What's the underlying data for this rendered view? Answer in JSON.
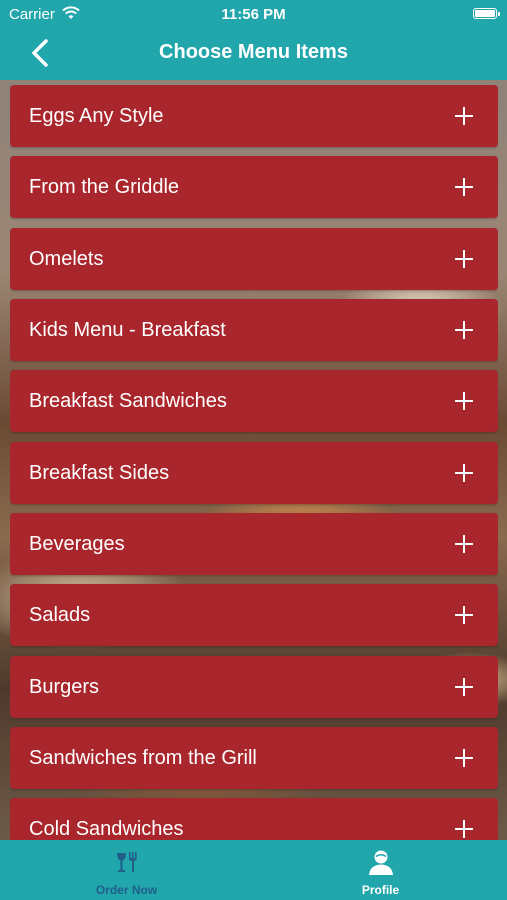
{
  "status_bar": {
    "carrier": "Carrier",
    "time": "11:56 PM"
  },
  "nav": {
    "title": "Choose Menu Items",
    "back_icon": "chevron-left-icon"
  },
  "menu": {
    "items": [
      {
        "label": "Eggs Any Style"
      },
      {
        "label": "From the Griddle"
      },
      {
        "label": "Omelets"
      },
      {
        "label": "Kids Menu - Breakfast"
      },
      {
        "label": "Breakfast Sandwiches"
      },
      {
        "label": "Breakfast Sides"
      },
      {
        "label": "Beverages"
      },
      {
        "label": "Salads"
      },
      {
        "label": "Burgers"
      },
      {
        "label": "Sandwiches from the Grill"
      },
      {
        "label": "Cold Sandwiches"
      }
    ],
    "expand_icon": "plus-icon"
  },
  "tab_bar": {
    "tabs": [
      {
        "label": "Order Now",
        "icon": "utensils-icon",
        "selected": true
      },
      {
        "label": "Profile",
        "icon": "person-icon",
        "selected": false
      }
    ]
  },
  "colors": {
    "teal": "#21a6ab",
    "item_red": "#a8262c",
    "selected_tab": "#1f5f8a"
  }
}
